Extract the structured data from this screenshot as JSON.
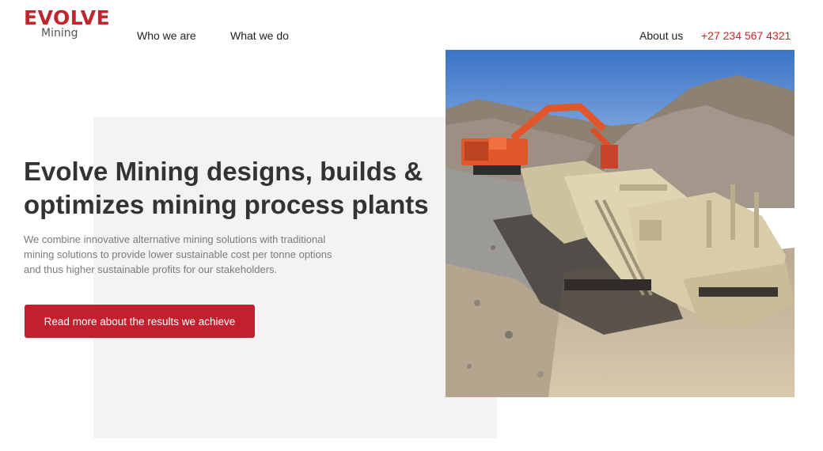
{
  "brand": {
    "logo_word": "EVOLVE",
    "logo_sub": "Mining",
    "accent_color": "#c0272d"
  },
  "nav": {
    "who_we_are": "Who we are",
    "what_we_do": "What we do",
    "about_us": "About us",
    "phone": "+27 234 567 4321"
  },
  "hero": {
    "title_line1": "Evolve Mining designs, builds &",
    "title_line2": "optimizes mining process plants",
    "description": "We combine innovative alternative mining solutions with traditional mining solutions to provide lower sustainable cost per tonne options and thus higher sustainable profits for our stakeholders.",
    "cta_label": "Read more about the results we achieve"
  }
}
